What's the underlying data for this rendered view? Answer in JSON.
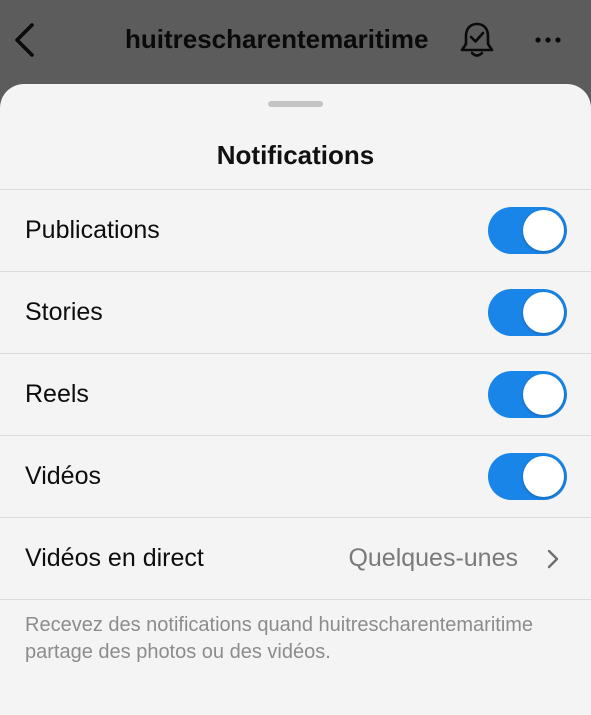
{
  "header": {
    "back_icon": "chevron-left-icon",
    "username": "huitrescharentemaritime",
    "bell_icon": "bell-check-icon",
    "more_icon": "more-horizontal-icon"
  },
  "sheet": {
    "title": "Notifications",
    "rows": [
      {
        "label": "Publications",
        "toggle_on": true
      },
      {
        "label": "Stories",
        "toggle_on": true
      },
      {
        "label": "Reels",
        "toggle_on": true
      },
      {
        "label": "Vidéos",
        "toggle_on": true
      }
    ],
    "live": {
      "label": "Vidéos en direct",
      "value": "Quelques-unes",
      "icon": "chevron-right-icon"
    },
    "helper_text": "Recevez des notifications quand huitrescharentemaritime partage des photos ou des vidéos."
  },
  "colors": {
    "toggle_on": "#1a85e8",
    "sheet_bg": "#f4f4f4",
    "backdrop": "#5c5c5c"
  }
}
